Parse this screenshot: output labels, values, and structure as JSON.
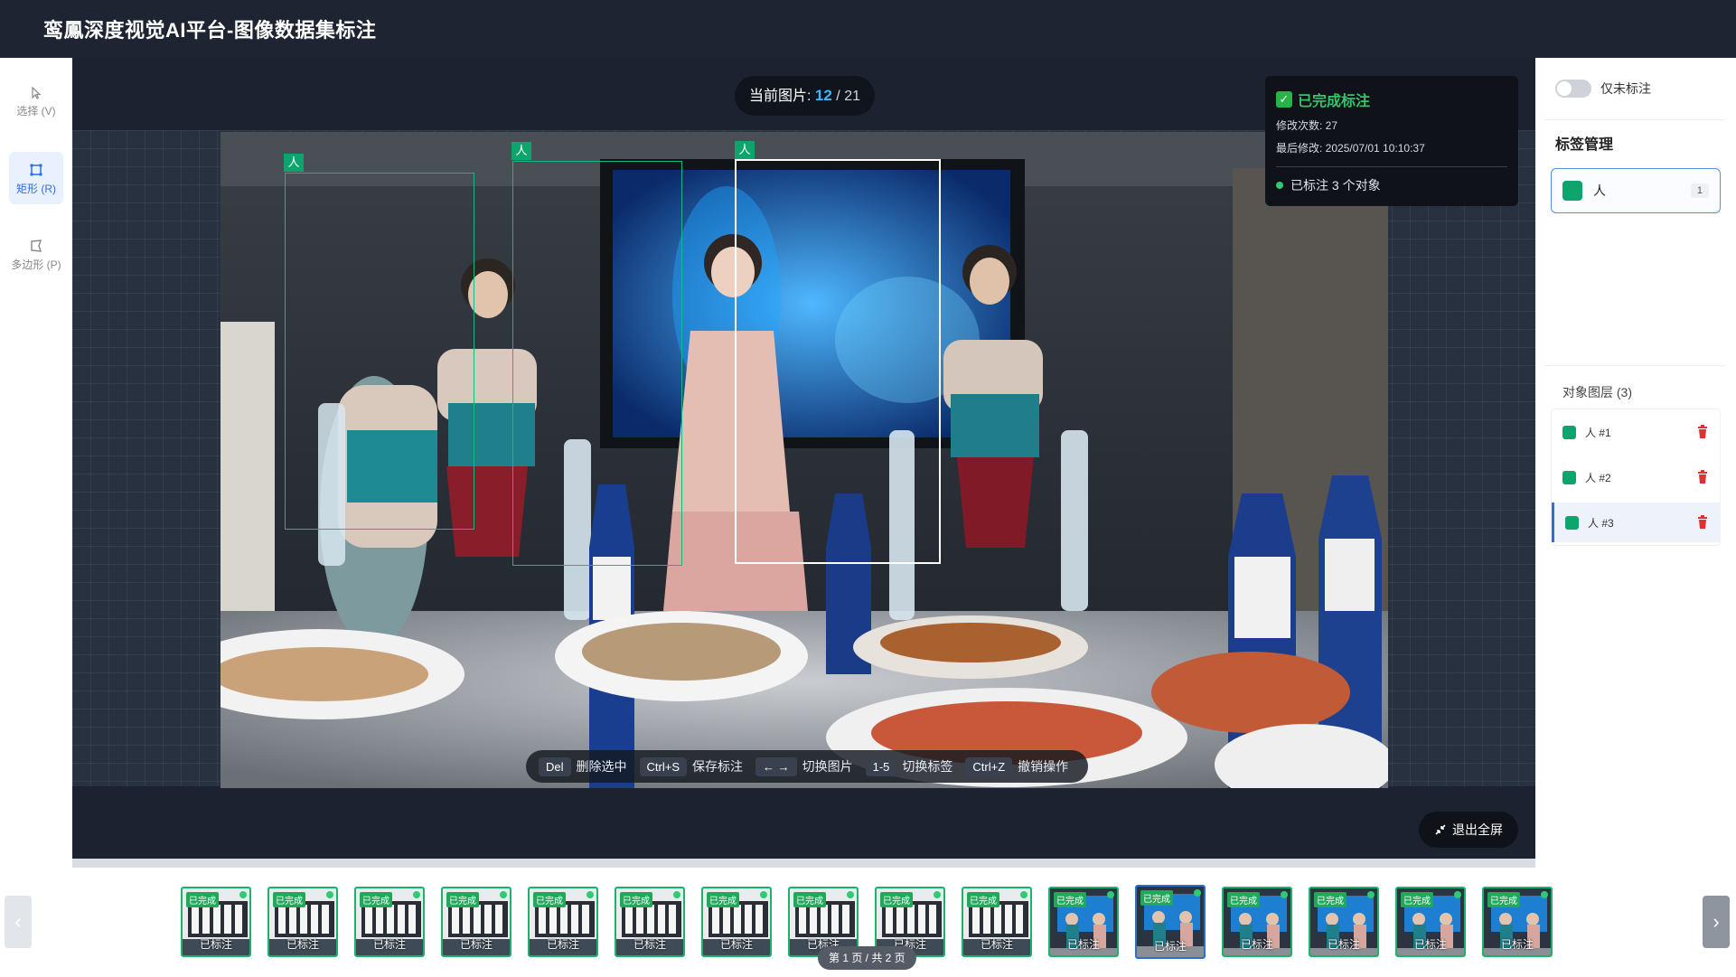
{
  "app": {
    "title": "鸾鳳深度视觉AI平台-图像数据集标注"
  },
  "tools": [
    {
      "label": "选择 (V)",
      "icon": "cursor-icon",
      "active": false
    },
    {
      "label": "矩形 (R)",
      "icon": "rectangle-icon",
      "active": true
    },
    {
      "label": "多边形 (P)",
      "icon": "polygon-icon",
      "active": false
    }
  ],
  "counter": {
    "prefix": "当前图片:",
    "current": "12",
    "separator": "/",
    "total": "21"
  },
  "status": {
    "title": "已完成标注",
    "edit_count": "修改次数: 27",
    "last_modified": "最后修改: 2025/07/01 10:10:37",
    "objects": "已标注 3 个对象"
  },
  "boxes": [
    {
      "label": "人",
      "selected": false
    },
    {
      "label": "人",
      "selected": false
    },
    {
      "label": "人",
      "selected": true
    }
  ],
  "shortcuts": [
    {
      "key": "Del",
      "desc": "删除选中"
    },
    {
      "key": "Ctrl+S",
      "desc": "保存标注"
    },
    {
      "key": "← →",
      "desc": "切换图片"
    },
    {
      "key": "1-5",
      "desc": "切换标签"
    },
    {
      "key": "Ctrl+Z",
      "desc": "撤销操作"
    }
  ],
  "exit_fullscreen": "退出全屏",
  "right_panel": {
    "toggle_label": "仅未标注",
    "label_section_title": "标签管理",
    "labels": [
      {
        "name": "人",
        "count": "1",
        "color": "#0ea46e"
      }
    ],
    "layers_title": "对象图层 (3)",
    "layers": [
      {
        "name": "人 #1",
        "selected": false
      },
      {
        "name": "人 #2",
        "selected": false
      },
      {
        "name": "人 #3",
        "selected": true
      }
    ]
  },
  "filmstrip": {
    "thumbnails": [
      {
        "badge": "已完成",
        "label": "已标注",
        "theme": "text"
      },
      {
        "badge": "已完成",
        "label": "已标注",
        "theme": "text"
      },
      {
        "badge": "已完成",
        "label": "已标注",
        "theme": "text"
      },
      {
        "badge": "已完成",
        "label": "已标注",
        "theme": "text"
      },
      {
        "badge": "已完成",
        "label": "已标注",
        "theme": "text"
      },
      {
        "badge": "已完成",
        "label": "已标注",
        "theme": "text"
      },
      {
        "badge": "已完成",
        "label": "已标注",
        "theme": "text"
      },
      {
        "badge": "已完成",
        "label": "已标注",
        "theme": "text"
      },
      {
        "badge": "已完成",
        "label": "已标注",
        "theme": "text"
      },
      {
        "badge": "已完成",
        "label": "已标注",
        "theme": "text"
      },
      {
        "badge": "已完成",
        "label": "已标注",
        "theme": "photo"
      },
      {
        "badge": "已完成",
        "label": "已标注",
        "theme": "photo",
        "current": true
      },
      {
        "badge": "已完成",
        "label": "已标注",
        "theme": "photo"
      },
      {
        "badge": "已完成",
        "label": "已标注",
        "theme": "photo"
      },
      {
        "badge": "已完成",
        "label": "已标注",
        "theme": "photo"
      },
      {
        "badge": "已完成",
        "label": "已标注",
        "theme": "photo"
      }
    ],
    "page_indicator": "第 1 页 / 共 2 页"
  },
  "colors": {
    "accent": "#2f6fdb",
    "label_green": "#0ea46e",
    "done_green": "#35c46a",
    "delete_red": "#e03131"
  }
}
